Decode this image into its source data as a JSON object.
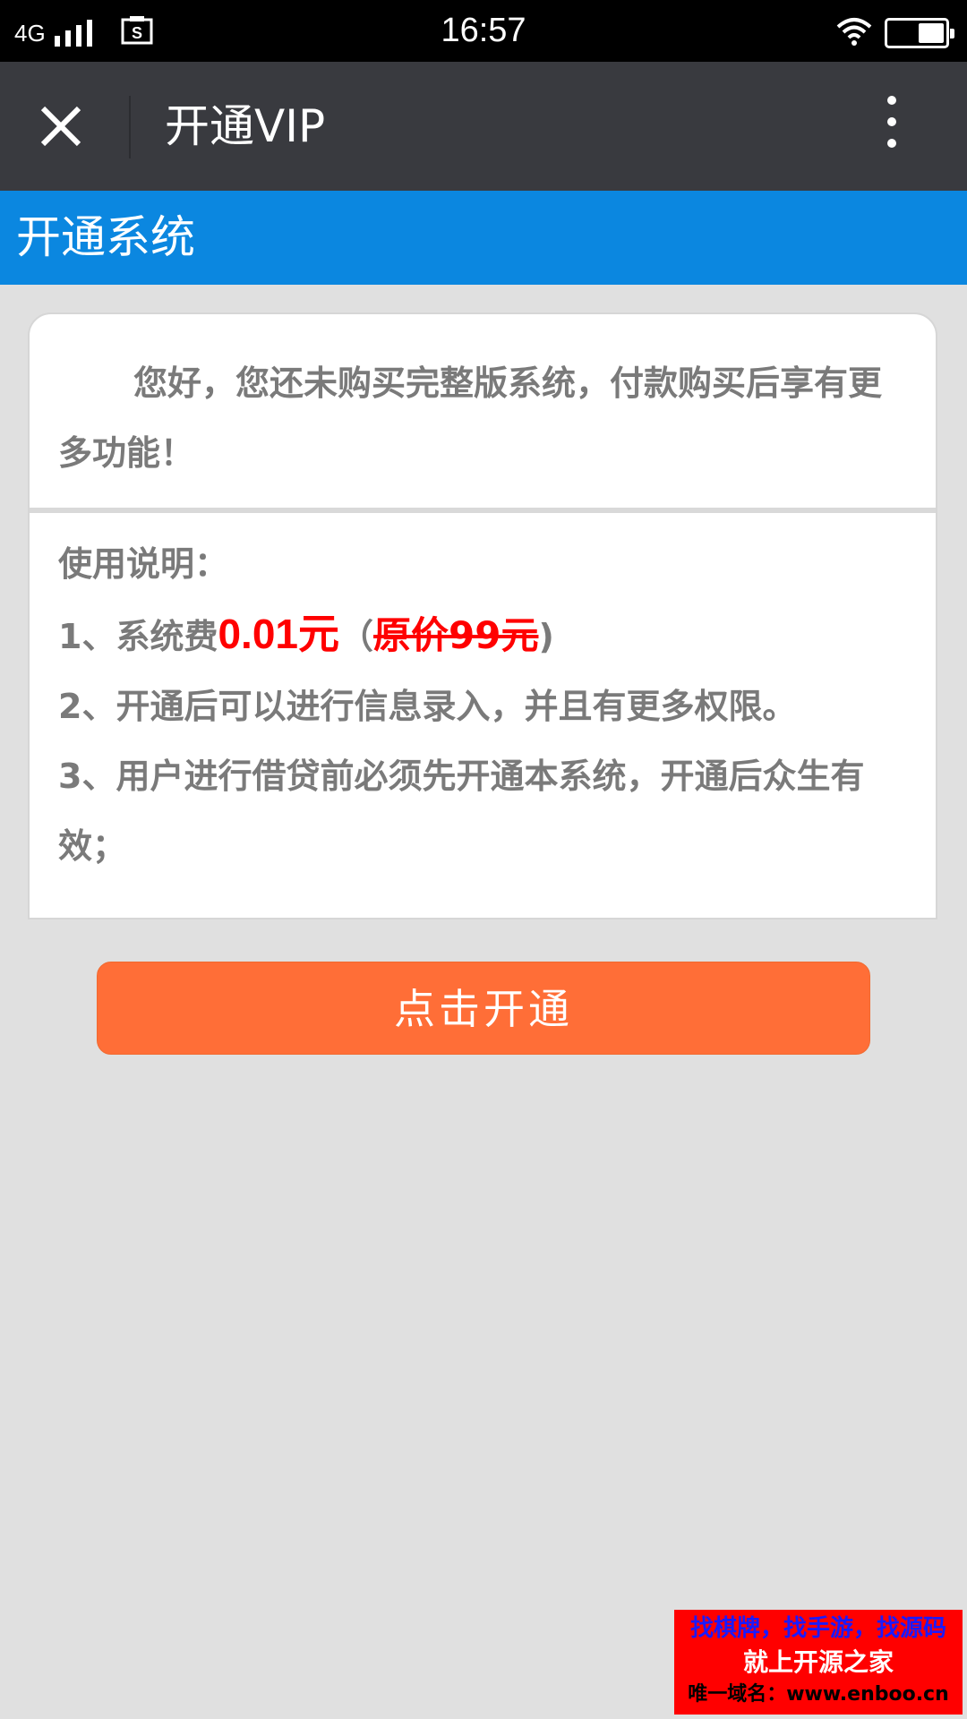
{
  "status_bar": {
    "network": "4G",
    "time": "16:57",
    "icons": [
      "signal-icon",
      "sim-icon",
      "wifi-icon",
      "battery-icon"
    ]
  },
  "title_bar": {
    "title": "开通VIP",
    "close_icon": "close-icon",
    "more_icon": "more-vertical-icon"
  },
  "section": {
    "title": "开通系统"
  },
  "card": {
    "intro": "您好，您还未购买完整版系统，付款购买后享有更多功能！",
    "instructions_heading": "使用说明：",
    "item1_prefix": "1、系统费",
    "item1_price": "0.01元",
    "item1_open": "（",
    "item1_orig": "原价99元",
    "item1_close": ")",
    "item2": "2、开通后可以进行信息录入，并且有更多权限。",
    "item3": "3、用户进行借贷前必须先开通本系统，开通后众生有效；"
  },
  "button": {
    "label": "点击开通"
  },
  "watermark": {
    "line1": "找棋牌，找手游，找源码",
    "line2": "就上开源之家",
    "line3": "唯一域名：www.enboo.cn"
  },
  "colors": {
    "title_bar_bg": "#393a3f",
    "section_bg": "#0b87e0",
    "button_bg": "#ff6e37",
    "price_red": "#ff0000",
    "page_bg": "#e0e0e0"
  }
}
